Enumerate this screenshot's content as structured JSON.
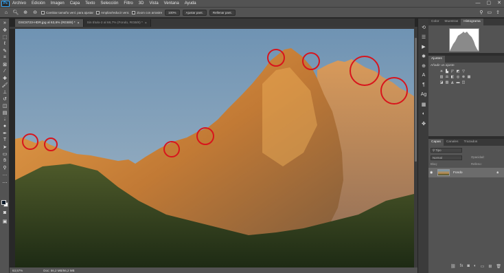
{
  "app": {
    "logo": "Ps"
  },
  "menu": [
    "Archivo",
    "Edición",
    "Imagen",
    "Capa",
    "Texto",
    "Selección",
    "Filtro",
    "3D",
    "Vista",
    "Ventana",
    "Ayuda"
  ],
  "window_controls": {
    "minimize": "—",
    "maximize": "▢",
    "close": "✕"
  },
  "options": {
    "tool_icon": "zoom-icon",
    "resize_label": "Cambiar tamaño venl. para ajustar",
    "all_windows_label": "Ampliar/reducir vent.",
    "scrubby_label": "Zoom con arrastre",
    "percent": "100%",
    "fit_label": "Ajustar pant.",
    "fill_label": "Rellenar pant."
  },
  "tabs": [
    {
      "label": "DSC8723-HDR.jpg al 63,6% (RGB/8) *",
      "close": "×"
    },
    {
      "label": "Sin título-2 al 66,7% (Fondo, RGB/8) *",
      "close": "×"
    }
  ],
  "status": {
    "zoom": "63,57%",
    "doc": "Doc: 56,2 MB/56,2 MB"
  },
  "panels": {
    "top_tabs": [
      "Color",
      "Muestras",
      "Histograma"
    ],
    "adjust_tab": "Ajustes",
    "adjust_heading": "Añadir un ajuste",
    "layers_tabs": [
      "Capas",
      "Canales",
      "Trazados"
    ],
    "search_placeholder": "Tipo",
    "blend_mode": "Normal",
    "opacity_label": "Opacidad:",
    "lock_label": "Bloq:",
    "fill_label": "Relleno:",
    "layer_name": "Fondo"
  },
  "colors": {
    "ui_gray": "#535353",
    "sky": "#7f9fba",
    "circle": "#d8141c"
  }
}
